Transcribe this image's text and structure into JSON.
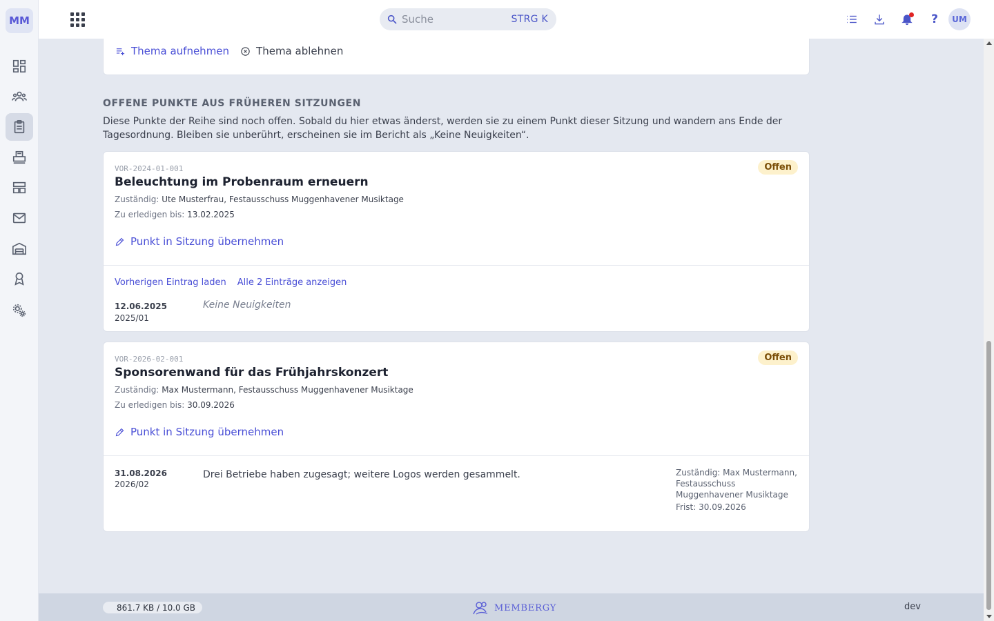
{
  "sidebar": {
    "logo": "MM",
    "items": [
      {
        "name": "dashboard-icon"
      },
      {
        "name": "members-icon"
      },
      {
        "name": "clipboard-icon",
        "active": true
      },
      {
        "name": "printer-icon"
      },
      {
        "name": "layout-icon"
      },
      {
        "name": "mail-icon"
      },
      {
        "name": "warehouse-icon"
      },
      {
        "name": "award-icon"
      },
      {
        "name": "settings-icon"
      }
    ]
  },
  "topbar": {
    "search_placeholder": "Suche",
    "search_shortcut": "STRG K",
    "help_label": "?",
    "avatar_initials": "UM"
  },
  "top_card": {
    "add_topic": "Thema aufnehmen",
    "reject_topic": "Thema ablehnen"
  },
  "section": {
    "title": "OFFENE PUNKTE AUS FRÜHEREN SITZUNGEN",
    "description": "Diese Punkte der Reihe sind noch offen. Sobald du hier etwas änderst, werden sie zu einem Punkt dieser Sitzung und wandern ans Ende der Tagesordnung. Bleiben sie unberührt, erscheinen sie im Bericht als „Keine Neuigkeiten“."
  },
  "items": [
    {
      "ref": "VOR-2024-01-001",
      "status": "Offen",
      "title": "Beleuchtung im Probenraum erneuern",
      "responsible_label": "Zuständig:",
      "responsible": "Ute Musterfrau, Festausschuss Muggenhavener Musiktage",
      "due_label": "Zu erledigen bis:",
      "due": "13.02.2025",
      "adopt": "Punkt in Sitzung übernehmen",
      "load_prev": "Vorherigen Eintrag laden",
      "show_all": "Alle 2 Einträge anzeigen",
      "history": {
        "date": "12.06.2025",
        "session": "2025/01",
        "text": "Keine Neuigkeiten"
      }
    },
    {
      "ref": "VOR-2026-02-001",
      "status": "Offen",
      "title": "Sponsorenwand für das Frühjahrskonzert",
      "responsible_label": "Zuständig:",
      "responsible": "Max Mustermann, Festausschuss Muggenhavener Musiktage",
      "due_label": "Zu erledigen bis:",
      "due": "30.09.2026",
      "adopt": "Punkt in Sitzung übernehmen",
      "history": {
        "date": "31.08.2026",
        "session": "2026/02",
        "text": "Drei Betriebe haben zugesagt; weitere Logos werden gesammelt.",
        "meta_responsible": "Zuständig: Max Mustermann, Festausschuss Muggenhavener Musiktage",
        "meta_due": "Frist: 30.09.2026"
      }
    }
  ],
  "footer": {
    "storage": "861.7 KB / 10.0 GB",
    "brand": "MEMBERGY",
    "env": "dev"
  },
  "colors": {
    "accent": "#4a4fd6",
    "badge_bg": "#fdf1cc",
    "badge_text": "#7a4d06",
    "background": "#e4e8f0"
  }
}
